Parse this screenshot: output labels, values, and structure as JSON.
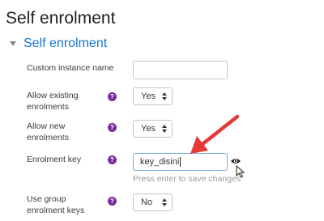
{
  "page": {
    "title": "Self enrolment"
  },
  "section": {
    "title": "Self enrolment",
    "caret_icon": "caret-down-icon"
  },
  "fields": {
    "instance_name": {
      "label": "Custom instance name",
      "value": ""
    },
    "allow_existing": {
      "label_line1": "Allow existing",
      "label_line2": "enrolments",
      "value": "Yes"
    },
    "allow_new": {
      "label_line1": "Allow new",
      "label_line2": "enrolments",
      "value": "Yes"
    },
    "enrolment_key": {
      "label": "Enrolment key",
      "value": "key_disini",
      "hint": "Press enter to save changes"
    },
    "group_keys": {
      "label_line1": "Use group",
      "label_line2": "enrolment keys",
      "value": "No"
    }
  },
  "icons": {
    "help": "help-icon",
    "eye": "eye-icon",
    "cursor": "mouse-cursor-icon",
    "annotation": "red-arrow-annotation"
  },
  "help_glyph": "?",
  "colors": {
    "accent": "#1177d1",
    "help": "#7a2b9a",
    "annotation": "#e53935",
    "focus_border": "#7aaee6"
  }
}
